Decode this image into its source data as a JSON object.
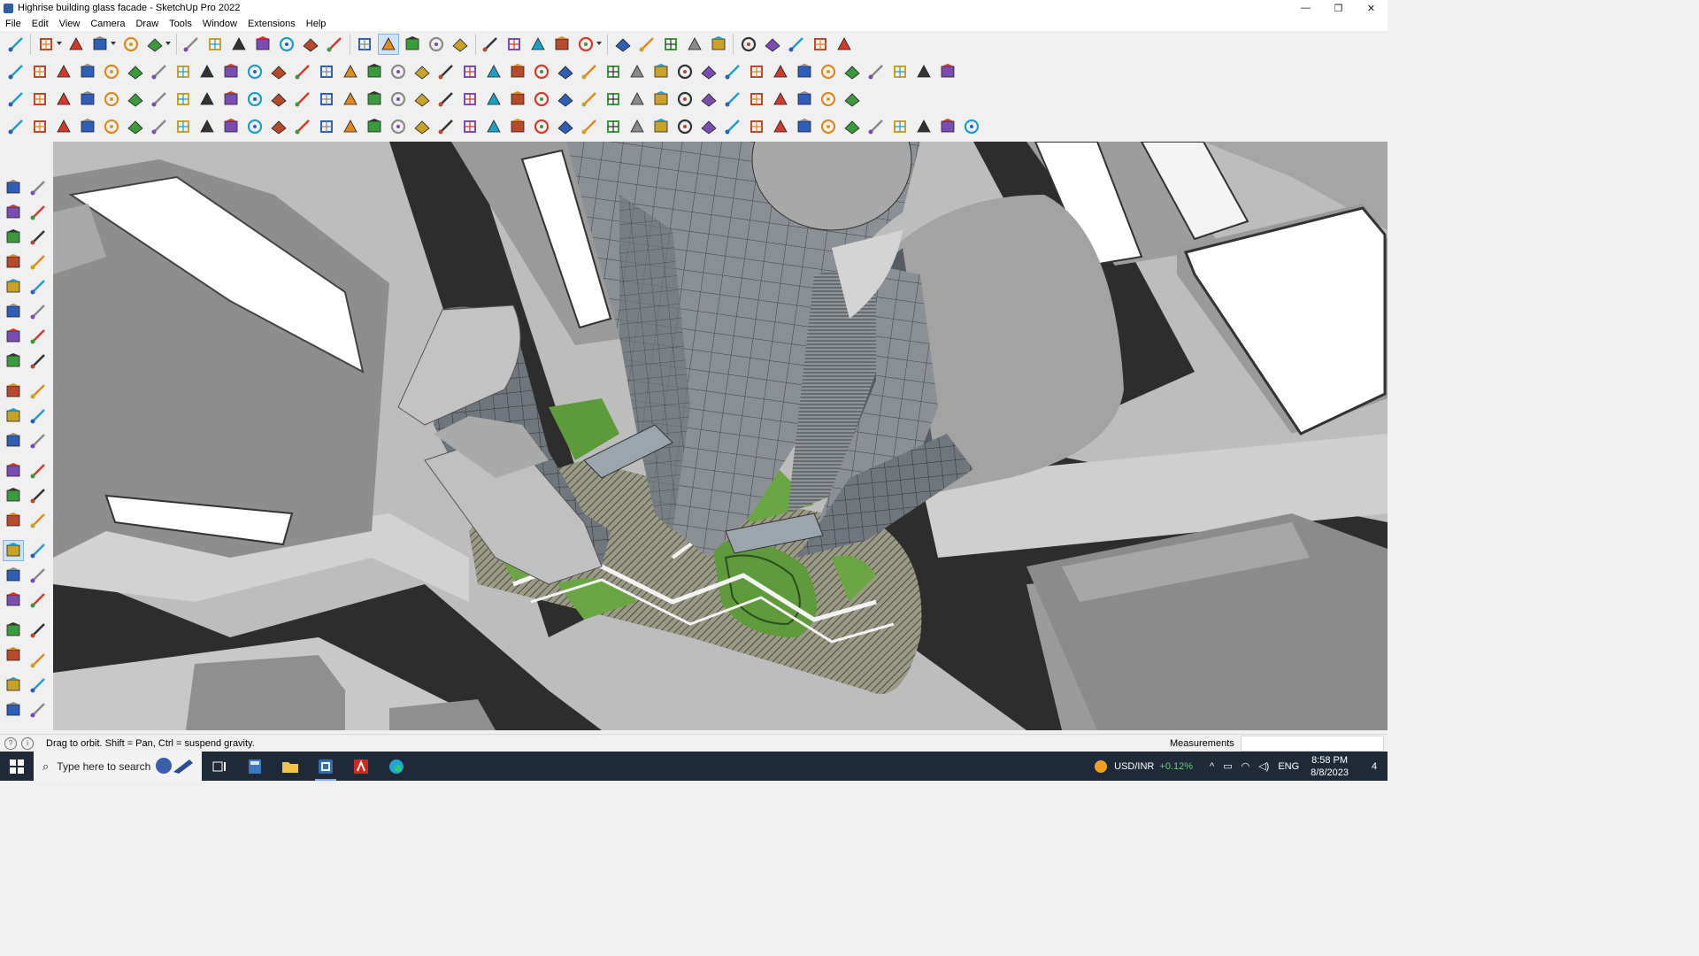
{
  "window": {
    "title": "Highrise building glass facade - SketchUp Pro 2022",
    "minimize_glyph": "—",
    "restore_glyph": "❐",
    "close_glyph": "✕"
  },
  "menu": [
    "File",
    "Edit",
    "View",
    "Camera",
    "Draw",
    "Tools",
    "Window",
    "Extensions",
    "Help"
  ],
  "toolbars": {
    "row1": [
      "zoom-window",
      "select",
      "eraser",
      "line",
      "arc",
      "shapes",
      "push-pull",
      "follow-me",
      "move",
      "rotate",
      "scale",
      "tape-measure",
      "text",
      "paint-bucket",
      "orbit",
      "pan",
      "zoom",
      "zoom-extents",
      "components",
      "section-plane",
      "layers",
      "styles",
      "user",
      "add-location",
      "geo-toggle",
      "sandbox",
      "push",
      "pull",
      "flip",
      "show-terrain",
      "undo",
      "redo",
      "warehouse"
    ],
    "row2": [
      "box",
      "sphere",
      "cylinder",
      "solid-union",
      "solid-subtract",
      "solid-trim",
      "solid-split",
      "outer-shell",
      "intersect",
      "follow",
      "iso-view",
      "top-view",
      "front-view",
      "right-view",
      "back-view",
      "left-view",
      "bottom-view",
      "house",
      "house-outline",
      "house-open",
      "extension-warehouse",
      "extension-manager",
      "text-style",
      "measure-red",
      "rectangle",
      "circle",
      "polygon",
      "ellipse",
      "freehand",
      "bezier",
      "lasso",
      "smooth",
      "contours",
      "scratch",
      "stamp",
      "drape",
      "add-detail",
      "flip-edge",
      "sandbox-from-scratch",
      "export"
    ],
    "row3": [
      "paint-blue",
      "paint-cyan",
      "paint-yellow",
      "paint-green",
      "paint-red",
      "paint-white",
      "undo-orange",
      "square-red",
      "panel",
      "paper",
      "bridge",
      "corner",
      "polyline",
      "cross-red",
      "cross-green",
      "cross-blue",
      "cone",
      "pyramid",
      "warning",
      "spiral",
      "loop",
      "knot",
      "compass",
      "box-brown",
      "curl",
      "gradient",
      "cube-red",
      "cube-red-2",
      "cube-green",
      "mesh",
      "layers-gold",
      "grid-orange",
      "grid-gold",
      "scatter",
      "curve-dots",
      "grid-dots"
    ],
    "row4": [
      "rotate-tool",
      "bezier-spline",
      "car",
      "scissors",
      "gear",
      "loft",
      "rope",
      "shell",
      "knot-2",
      "swirl",
      "bend",
      "bend-2",
      "line-corner",
      "break",
      "bridge-2",
      "dome",
      "clip",
      "columns",
      "pump",
      "hand",
      "leaf",
      "arrow-bold",
      "bundle",
      "fan",
      "spread",
      "spread-2",
      "spread-3",
      "spread-4",
      "bus",
      "stairs",
      "roof",
      "facade-1",
      "facade-2",
      "facade-3",
      "facade-4",
      "facade-5",
      "facade-6",
      "facade-7",
      "facade-8",
      "fins",
      "house-3d"
    ]
  },
  "left_tools": [
    "select",
    "orbit-lasso",
    "paint",
    "eraser",
    "component",
    "pencil",
    "line",
    "freehand",
    "rectangle",
    "rotated-rectangle",
    "circle",
    "polygon",
    "arc",
    "pie",
    "2pt-arc",
    "3pt-arc",
    "move",
    "push-pull",
    "rotate",
    "follow-me",
    "scale",
    "offset",
    "tape",
    "dimension",
    "protractor",
    "text",
    "axes",
    "3d-text",
    "orbit",
    "pan",
    "zoom",
    "zoom-window",
    "zoom-extents",
    "previous",
    "position-camera",
    "look-around",
    "walk",
    "section-plane",
    "components",
    "layers",
    "styles",
    "section-fill"
  ],
  "status": {
    "hint": "Drag to orbit. Shift = Pan, Ctrl = suspend gravity.",
    "measurements_label": "Measurements",
    "measurements_value": ""
  },
  "taskbar": {
    "search_placeholder": "Type here to search",
    "currency": "USD/INR",
    "currency_change": "+0.12%",
    "language": "ENG",
    "time": "8:58 PM",
    "date": "8/8/2023",
    "notification_count": "4"
  }
}
